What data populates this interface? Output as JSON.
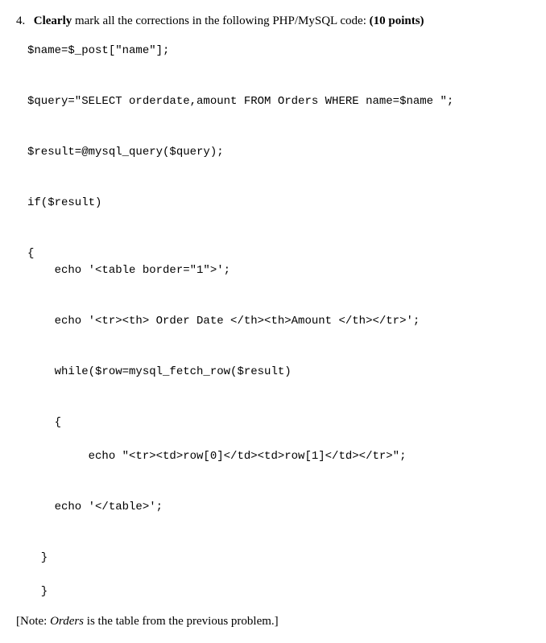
{
  "question": {
    "number": "4.",
    "bold_word": "Clearly",
    "text_after_bold": " mark all the corrections in the following PHP/MySQL code: ",
    "points": "(10 points)"
  },
  "code": {
    "line1": "$name=$_post[\"name\"];",
    "line2": "$query=\"SELECT orderdate,amount FROM Orders WHERE name=$name \";",
    "line3": "$result=@mysql_query($query);",
    "line4": "if($result)",
    "line5": "{",
    "line6": "    echo '<table border=\"1\">';",
    "line7": "    echo '<tr><th> Order Date </th><th>Amount </th></tr>';",
    "line8": "    while($row=mysql_fetch_row($result)",
    "line9": "    {",
    "line10": "         echo \"<tr><td>row[0]</td><td>row[1]</td></tr>\";",
    "line11": "    echo '</table>';",
    "line12": "  }",
    "line13": "  }"
  },
  "note": {
    "prefix": "[Note: ",
    "italic": "Orders",
    "suffix": " is the table from the previous problem.]"
  }
}
